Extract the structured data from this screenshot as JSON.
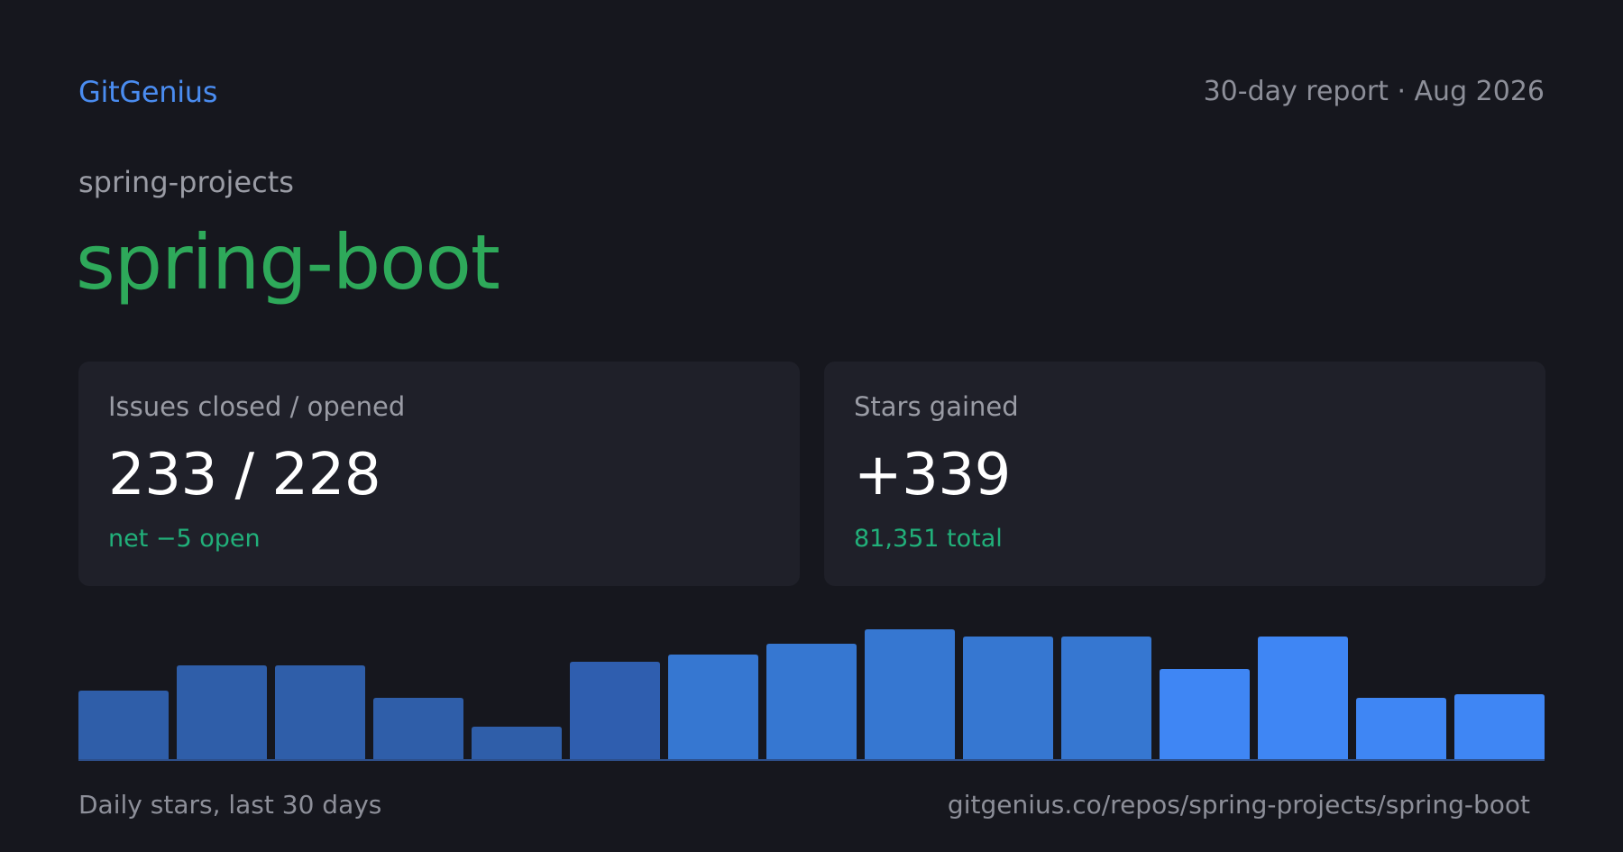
{
  "header": {
    "brand": "GitGenius",
    "report_label": "30-day report · Aug 2026"
  },
  "repo": {
    "owner": "spring-projects",
    "name": "spring-boot"
  },
  "cards": {
    "issues": {
      "label": "Issues closed / opened",
      "value": "233 / 228",
      "sub": "net −5 open"
    },
    "stars": {
      "label": "Stars gained",
      "value": "+339",
      "sub": "81,351 total"
    }
  },
  "footer": {
    "caption": "Daily stars, last 30 days",
    "url": "gitgenius.co/repos/spring-projects/spring-boot"
  },
  "colors": {
    "background": "#16171e",
    "card": "#1f2029",
    "brand": "#4a8cf0",
    "repo_name": "#2ea95a",
    "positive": "#21b07a",
    "baseline": "#2d4f8a"
  },
  "chart_data": {
    "type": "bar",
    "values": [
      19,
      26,
      26,
      17,
      9,
      27,
      29,
      32,
      36,
      34,
      34,
      25,
      34,
      17,
      18
    ],
    "colors": [
      "#2f5ea9",
      "#2f5ea9",
      "#2f5ea9",
      "#2f5ea9",
      "#2f5ea9",
      "#2f5eaf",
      "#3677d1",
      "#3677d1",
      "#3677d1",
      "#3677d1",
      "#3677d1",
      "#3f86f4",
      "#3f86f4",
      "#3f86f4",
      "#3f86f4"
    ],
    "ylim": [
      0,
      36
    ],
    "grid": false,
    "legend": "none"
  }
}
